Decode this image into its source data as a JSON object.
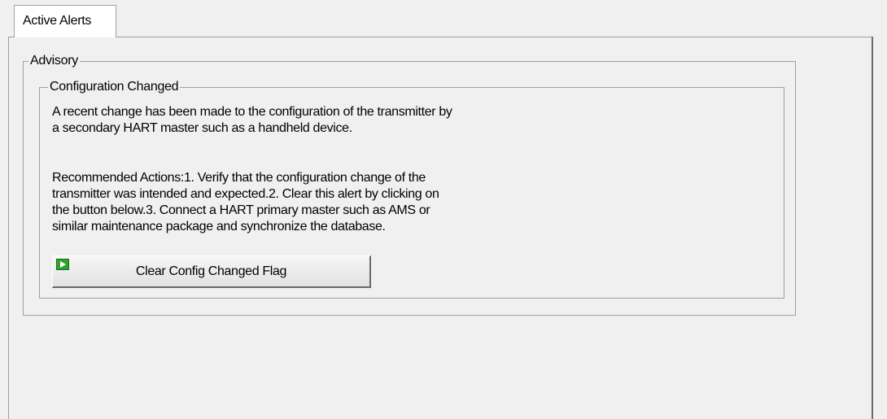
{
  "tabs": [
    {
      "label": "Active Alerts"
    }
  ],
  "advisory": {
    "legend": "Advisory",
    "alert": {
      "legend": "Configuration Changed",
      "description": "A recent change has been made to the configuration of the transmitter by a secondary HART master such as a handheld device.",
      "recommended_actions": "Recommended Actions:1. Verify that the configuration change of the transmitter was intended and expected.2. Clear this alert by clicking on the button below.3. Connect a HART primary master such as AMS or similar maintenance package and synchronize the database.",
      "button": {
        "label": "Clear Config Changed Flag",
        "icon": "play-method-icon",
        "icon_color": "#2fa32f"
      }
    }
  }
}
